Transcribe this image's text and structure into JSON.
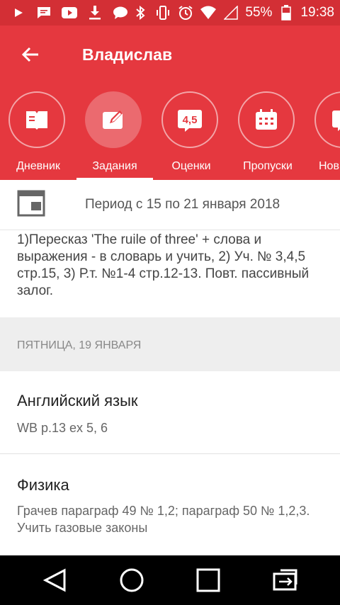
{
  "status_bar": {
    "battery": "55%",
    "time": "19:38",
    "icons": [
      "play-icon",
      "message-icon",
      "youtube-icon",
      "download-icon",
      "chat-icon",
      "bluetooth-icon",
      "vibrate-icon",
      "alarm-icon",
      "wifi-icon",
      "signal-icon",
      "battery-icon"
    ]
  },
  "header": {
    "title": "Владислав",
    "back_icon": "arrow-left-icon"
  },
  "tabs": [
    {
      "label": "Дневник",
      "icon": "diary-icon"
    },
    {
      "label": "Задания",
      "icon": "edit-icon",
      "active": true
    },
    {
      "label": "Оценки",
      "icon": "grades-icon",
      "icon_text": "4,5"
    },
    {
      "label": "Пропуски",
      "icon": "calendar-icon"
    },
    {
      "label": "Нов",
      "icon": "news-icon"
    }
  ],
  "period": {
    "text": "Период с 15 по 21 января 2018",
    "icon": "calendar-view-icon"
  },
  "assignment_previous": "1)Пересказ 'The ruile of three' + слова и выражения - в словарь и учить, 2) Уч. № 3,4,5 стр.15, 3) Р.т. №1-4 стр.12-13. Повт. пассивный залог.",
  "day_header": "ПЯТНИЦА, 19 ЯНВАРЯ",
  "subjects": [
    {
      "name": "Английский язык",
      "task": "WB p.13 ex 5, 6"
    },
    {
      "name": "Физика",
      "task": "Грачев параграф 49 № 1,2; параграф 50 № 1,2,3. Учить газовые законы"
    }
  ],
  "nav": [
    "back-triangle-icon",
    "home-circle-icon",
    "recents-square-icon",
    "switch-icon"
  ],
  "colors": {
    "accent": "#e5383f",
    "status": "#d32f35"
  }
}
